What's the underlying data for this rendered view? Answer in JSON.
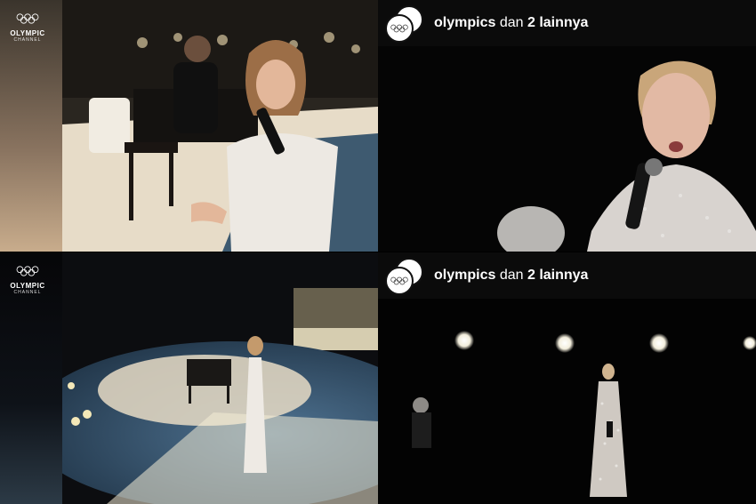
{
  "panels": {
    "top_left": {
      "watermark": {
        "name": "OLYMPIC",
        "sub": "CHANNEL",
        "icon": "olympic-rings-icon"
      }
    },
    "top_right": {
      "header": {
        "username": "olympics",
        "joiner": "dan",
        "count_text": "2 lainnya",
        "icon": "olympic-rings-icon"
      }
    },
    "bottom_left": {
      "watermark": {
        "name": "OLYMPIC",
        "sub": "CHANNEL",
        "icon": "olympic-rings-icon"
      }
    },
    "bottom_right": {
      "header": {
        "username": "olympics",
        "joiner": "dan",
        "count_text": "2 lainnya",
        "icon": "olympic-rings-icon"
      }
    }
  },
  "colors": {
    "stage_blue": "#3a5b78",
    "gown_white": "#ece8e4",
    "background": "#000000"
  }
}
